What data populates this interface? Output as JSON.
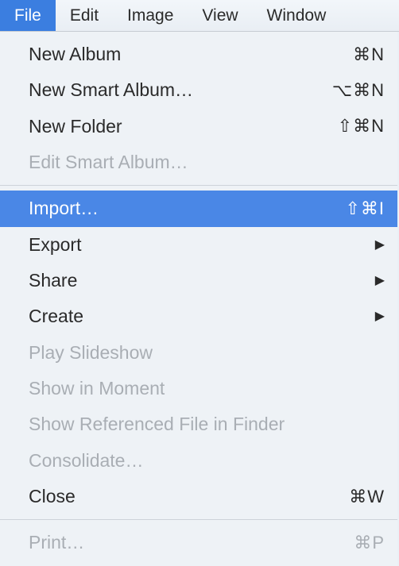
{
  "menubar": {
    "items": [
      {
        "label": "File",
        "active": true
      },
      {
        "label": "Edit",
        "active": false
      },
      {
        "label": "Image",
        "active": false
      },
      {
        "label": "View",
        "active": false
      },
      {
        "label": "Window",
        "active": false
      }
    ]
  },
  "dropdown": {
    "sections": [
      [
        {
          "label": "New Album",
          "shortcut": "⌘N",
          "enabled": true
        },
        {
          "label": "New Smart Album…",
          "shortcut": "⌥⌘N",
          "enabled": true
        },
        {
          "label": "New Folder",
          "shortcut": "⇧⌘N",
          "enabled": true
        },
        {
          "label": "Edit Smart Album…",
          "shortcut": "",
          "enabled": false
        }
      ],
      [
        {
          "label": "Import…",
          "shortcut": "⇧⌘I",
          "enabled": true,
          "highlighted": true
        },
        {
          "label": "Export",
          "submenu": true,
          "enabled": true
        },
        {
          "label": "Share",
          "submenu": true,
          "enabled": true
        },
        {
          "label": "Create",
          "submenu": true,
          "enabled": true
        },
        {
          "label": "Play Slideshow",
          "enabled": false
        },
        {
          "label": "Show in Moment",
          "enabled": false
        },
        {
          "label": "Show Referenced File in Finder",
          "enabled": false
        },
        {
          "label": "Consolidate…",
          "enabled": false
        },
        {
          "label": "Close",
          "shortcut": "⌘W",
          "enabled": true
        }
      ],
      [
        {
          "label": "Print…",
          "shortcut": "⌘P",
          "enabled": false
        }
      ]
    ]
  }
}
